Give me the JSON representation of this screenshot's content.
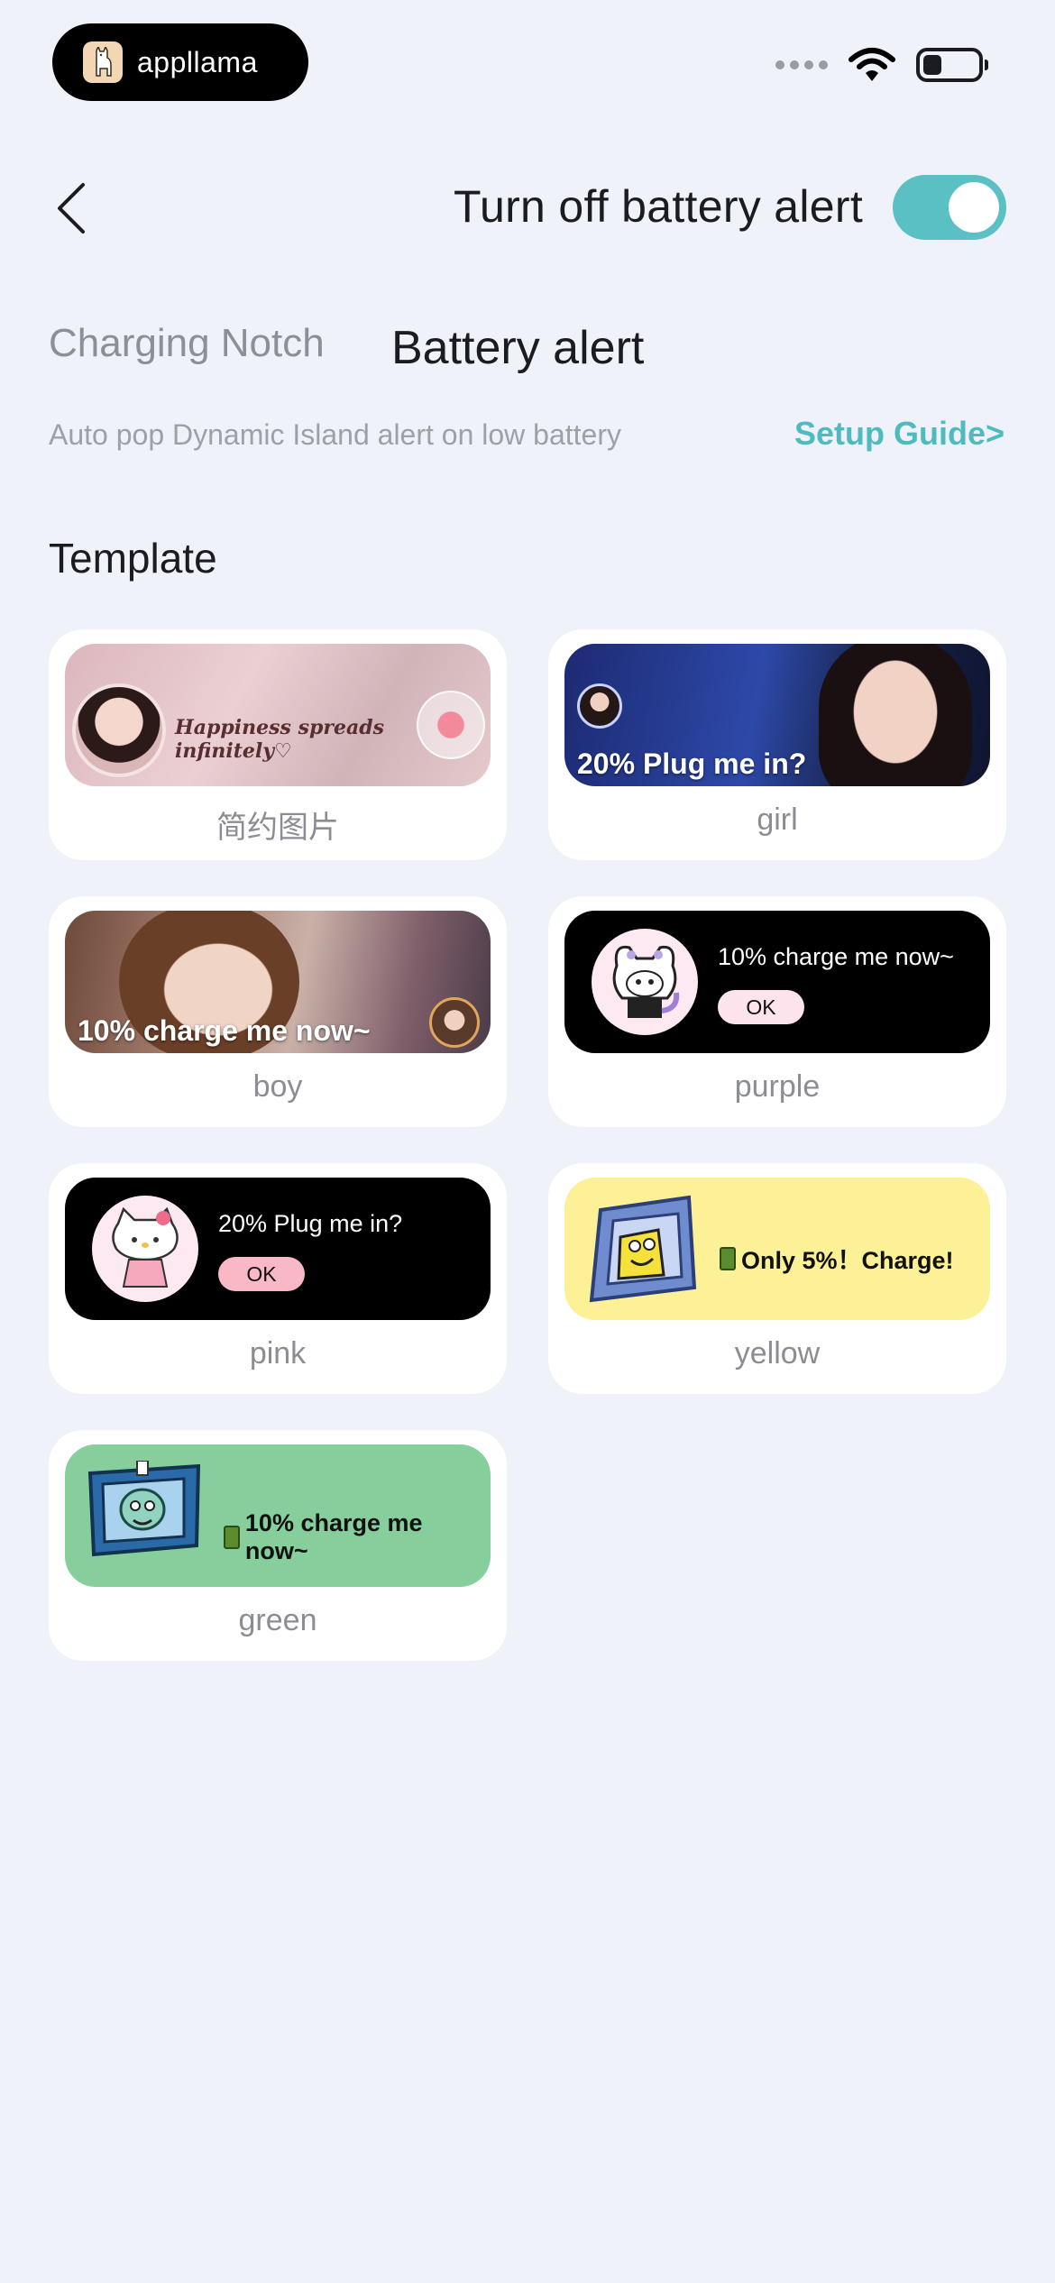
{
  "status_bar": {
    "brand": "appllama",
    "icons": [
      "signal-dots-icon",
      "wifi-icon",
      "battery-icon"
    ]
  },
  "header": {
    "title": "Turn off battery alert",
    "toggle_on": true,
    "accent_color": "#5bc0c4"
  },
  "tabs": [
    {
      "label": "Charging Notch",
      "active": false
    },
    {
      "label": "Battery alert",
      "active": true
    }
  ],
  "description": "Auto pop Dynamic Island alert on low battery",
  "setup_guide": "Setup Guide>",
  "section_title": "Template",
  "templates": [
    {
      "label": "简约图片",
      "preview_text": "Happiness spreads infinitely♡"
    },
    {
      "label": "girl",
      "preview_text": "20% Plug me in?"
    },
    {
      "label": "boy",
      "preview_text": "10% charge me now~"
    },
    {
      "label": "purple",
      "preview_text": "10% charge me now~",
      "button": "OK"
    },
    {
      "label": "pink",
      "preview_text": "20% Plug me in?",
      "button": "OK"
    },
    {
      "label": "yellow",
      "preview_text": "Only 5%！Charge!"
    },
    {
      "label": "green",
      "preview_text": "10% charge me now~"
    }
  ]
}
